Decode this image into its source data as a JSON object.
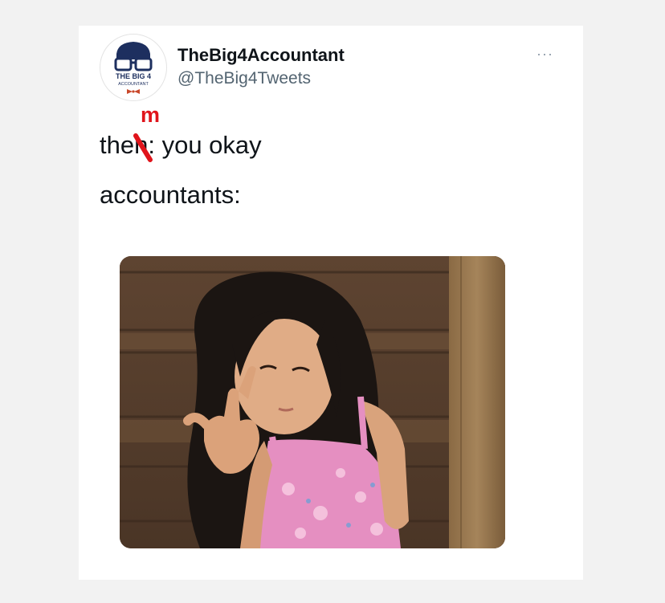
{
  "tweet": {
    "display_name": "TheBig4Accountant",
    "handle": "@TheBig4Tweets",
    "more_label": "···",
    "avatar_logo_text": [
      "THE BIG 4",
      "ACCOUNTANT"
    ],
    "line1_prefix": "the",
    "line1_struck_letter": "n",
    "line1_suffix": ": you okay",
    "line1_correction": "m",
    "line2": "accountants:"
  },
  "colors": {
    "text": "#0f1419",
    "handle": "#536471",
    "correction": "#e0141b",
    "avatar_navy": "#1d2f5f"
  }
}
